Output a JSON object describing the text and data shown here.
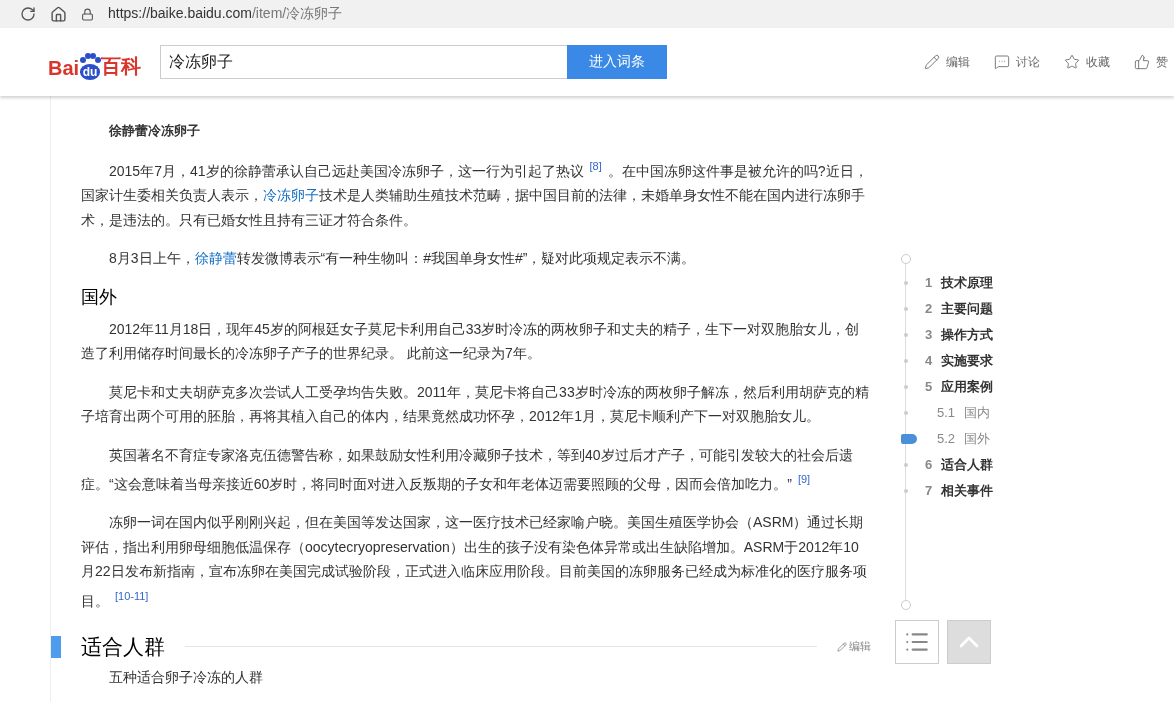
{
  "browser": {
    "url_host": "https://baike.baidu.com",
    "url_path": "/item/冷冻卵子"
  },
  "header": {
    "logo": {
      "left": "Bai",
      "paw": "du",
      "right": "百科"
    },
    "search": {
      "value": "冷冻卵子"
    },
    "search_button": "进入词条",
    "actions": [
      {
        "kind": "edit",
        "label": "编辑"
      },
      {
        "kind": "discuss",
        "label": "讨论"
      },
      {
        "kind": "favorite",
        "label": "收藏"
      },
      {
        "kind": "like",
        "label": "赞"
      }
    ]
  },
  "article": [
    {
      "kind": "subheading",
      "text": "徐静蕾冷冻卵子"
    },
    {
      "kind": "paragraph",
      "segments": [
        {
          "kind": "text",
          "text": "2015年7月，41岁的徐静蕾承认自己远赴美国冷冻卵子，这一行为引起了热议"
        },
        {
          "kind": "ref",
          "text": "[8]"
        },
        {
          "kind": "text",
          "text": "。在中国冻卵这件事是被允许的吗?近日，国家计生委相关负责人表示，"
        },
        {
          "kind": "link",
          "text": "冷冻卵子"
        },
        {
          "kind": "text",
          "text": "技术是人类辅助生殖技术范畴，据中国目前的法律，未婚单身女性不能在国内进行冻卵手术，是违法的。只有已婚女性且持有三证才符合条件。"
        }
      ]
    },
    {
      "kind": "paragraph",
      "segments": [
        {
          "kind": "text",
          "text": "8月3日上午，"
        },
        {
          "kind": "link",
          "text": "徐静蕾"
        },
        {
          "kind": "text",
          "text": "转发微博表示“有一种生物叫：#我国单身女性#”，疑对此项规定表示不满。"
        }
      ]
    },
    {
      "kind": "heading",
      "text": "国外"
    },
    {
      "kind": "paragraph",
      "segments": [
        {
          "kind": "text",
          "text": "2012年11月18日，现年45岁的阿根廷女子莫尼卡利用自己33岁时冷冻的两枚卵子和丈夫的精子，生下一对双胞胎女儿，创造了利用储存时间最长的冷冻卵子产子的世界纪录。 此前这一纪录为7年。"
        }
      ]
    },
    {
      "kind": "paragraph",
      "segments": [
        {
          "kind": "text",
          "text": "莫尼卡和丈夫胡萨克多次尝试人工受孕均告失败。2011年，莫尼卡将自己33岁时冷冻的两枚卵子解冻，然后利用胡萨克的精子培育出两个可用的胚胎，再将其植入自己的体内，结果竟然成功怀孕，2012年1月，莫尼卡顺利产下一对双胞胎女儿。"
        }
      ]
    },
    {
      "kind": "paragraph",
      "segments": [
        {
          "kind": "text",
          "text": "英国著名不育症专家洛克伍德警告称，如果鼓励女性利用冷藏卵子技术，等到40岁过后才产子，可能引发较大的社会后遗症。“这会意味着当母亲接近60岁时，将同时面对进入反叛期的子女和年老体迈需要照顾的父母，因而会倍加吃力。”"
        },
        {
          "kind": "ref",
          "text": "[9]"
        }
      ]
    },
    {
      "kind": "paragraph",
      "segments": [
        {
          "kind": "text",
          "text": "冻卵一词在国内似乎刚刚兴起，但在美国等发达国家，这一医疗技术已经家喻户晓。美国生殖医学协会（ASRM）通过长期评估，指出利用卵母细胞低温保存（oocytecryopreservation）出生的孩子没有染色体异常或出生缺陷增加。ASRM于2012年10月22日发布新指南，宣布冻卵在美国完成试验阶段，正式进入临床应用阶段。目前美国的冻卵服务已经成为标准化的医疗服务项目。"
        },
        {
          "kind": "ref",
          "text": "[10-11]"
        }
      ]
    },
    {
      "kind": "section",
      "text": "适合人群",
      "edit": "编辑"
    },
    {
      "kind": "paragraph",
      "segments": [
        {
          "kind": "text",
          "text": "五种适合卵子冷冻的人群"
        }
      ]
    }
  ],
  "toc": [
    {
      "number": "1",
      "label": "技术原理",
      "sub": false,
      "selected": false
    },
    {
      "number": "2",
      "label": "主要问题",
      "sub": false,
      "selected": false
    },
    {
      "number": "3",
      "label": "操作方式",
      "sub": false,
      "selected": false
    },
    {
      "number": "4",
      "label": "实施要求",
      "sub": false,
      "selected": false
    },
    {
      "number": "5",
      "label": "应用案例",
      "sub": false,
      "selected": false
    },
    {
      "number": "5.1",
      "label": "国内",
      "sub": true,
      "selected": false
    },
    {
      "number": "5.2",
      "label": "国外",
      "sub": true,
      "selected": true
    },
    {
      "number": "6",
      "label": "适合人群",
      "sub": false,
      "selected": false
    },
    {
      "number": "7",
      "label": "相关事件",
      "sub": false,
      "selected": false
    }
  ]
}
